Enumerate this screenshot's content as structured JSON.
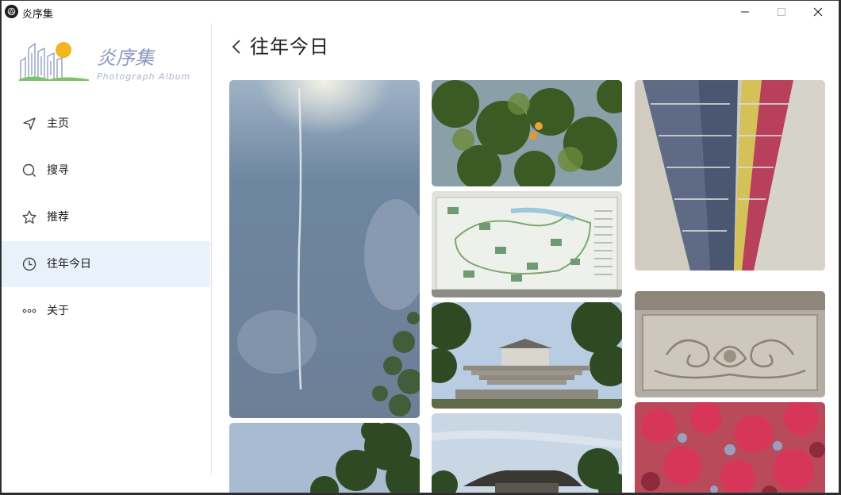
{
  "window": {
    "title": "炎序集"
  },
  "logo": {
    "name": "炎序集",
    "subtitle": "Photograph Album"
  },
  "sidebar": {
    "items": [
      {
        "label": "主页",
        "icon": "navigation-arrow-icon",
        "active": false
      },
      {
        "label": "搜寻",
        "icon": "search-icon",
        "active": false
      },
      {
        "label": "推荐",
        "icon": "star-icon",
        "active": false
      },
      {
        "label": "往年今日",
        "icon": "clock-icon",
        "active": true
      },
      {
        "label": "关于",
        "icon": "more-dots-icon",
        "active": false
      }
    ]
  },
  "main": {
    "title": "往年今日"
  },
  "colors": {
    "accent_bg": "#e9f1fb",
    "logo_sun": "#f2b420",
    "logo_grass": "#7cc36a",
    "logo_lines": "#8a97c0"
  },
  "photos": [
    {
      "subject": "sky with contrail"
    },
    {
      "subject": "tree branches with oranges"
    },
    {
      "subject": "park map board"
    },
    {
      "subject": "stone stairs with building"
    },
    {
      "subject": "pavilion rooftop"
    },
    {
      "subject": "bridge underside with pipes"
    },
    {
      "subject": "stone carving relief"
    },
    {
      "subject": "red maple leaves"
    },
    {
      "subject": "green tree leaves"
    }
  ]
}
